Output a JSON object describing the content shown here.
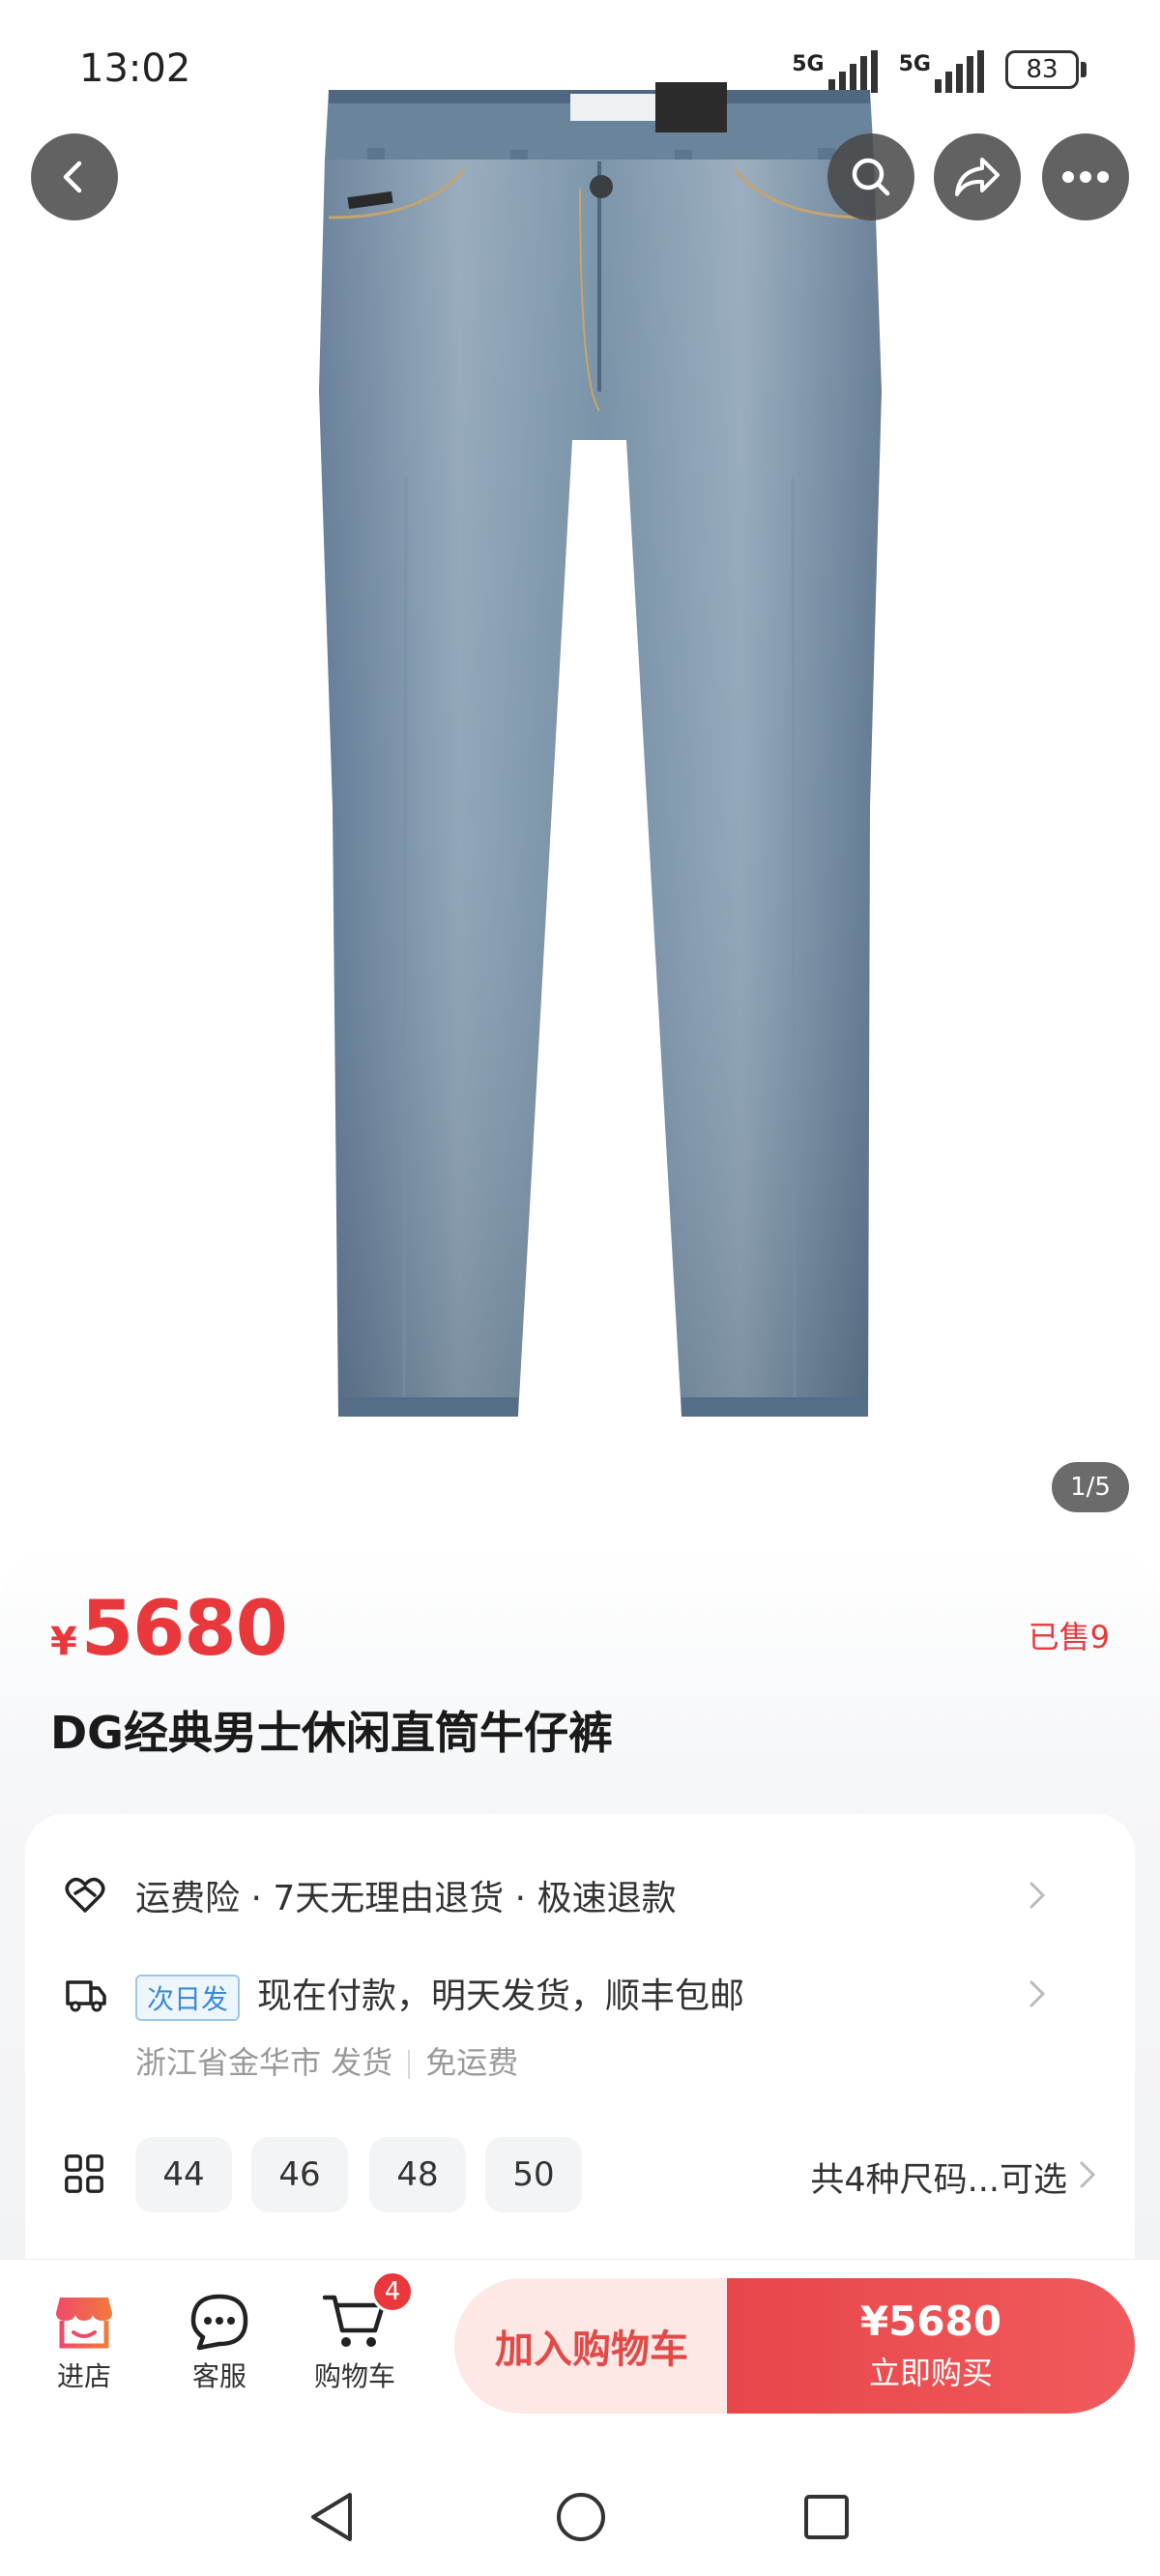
{
  "status_bar": {
    "time": "13:02",
    "network1": "5G",
    "network2": "5G",
    "battery": "83"
  },
  "nav": {
    "back_icon": "chevron-left-icon",
    "search_icon": "search-icon",
    "share_icon": "share-icon",
    "more_icon": "more-dots-icon"
  },
  "gallery": {
    "counter": "1/5"
  },
  "product": {
    "price_symbol": "¥",
    "price": "5680",
    "sold": "已售9",
    "title": "DG经典男士休闲直筒牛仔裤"
  },
  "service": {
    "guarantee": "运费险 · 7天无理由退货 · 极速退款",
    "shipping_tag": "次日发",
    "shipping": "现在付款，明天发货，顺丰包邮",
    "origin": "浙江省金华市 发货",
    "freight": "免运费"
  },
  "sizes": {
    "options": [
      "44",
      "46",
      "48",
      "50"
    ],
    "summary": "共4种尺码...可选"
  },
  "bottom_bar": {
    "shop_label": "进店",
    "service_label": "客服",
    "cart_label": "购物车",
    "cart_count": "4",
    "add_to_cart": "加入购物车",
    "buy_price": "¥5680",
    "buy_now": "立即购买"
  },
  "colors": {
    "accent": "#e8383c",
    "denim": "#6f8aa3"
  }
}
